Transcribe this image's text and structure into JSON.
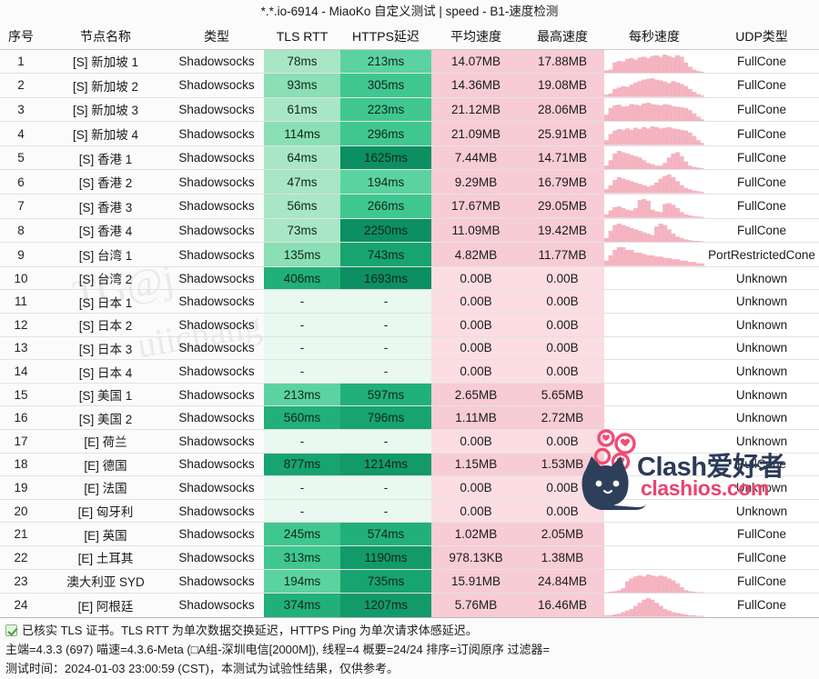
{
  "window": {
    "title": "*.*.io-6914 - MiaoKo 自定义测试 | speed - B1-速度检测"
  },
  "table": {
    "columns": [
      {
        "key": "idx",
        "label": "序号"
      },
      {
        "key": "name",
        "label": "节点名称"
      },
      {
        "key": "type",
        "label": "类型"
      },
      {
        "key": "tls",
        "label": "TLS RTT"
      },
      {
        "key": "https",
        "label": "HTTPS延迟"
      },
      {
        "key": "avg",
        "label": "平均速度"
      },
      {
        "key": "max",
        "label": "最高速度"
      },
      {
        "key": "sec",
        "label": "每秒速度"
      },
      {
        "key": "udp",
        "label": "UDP类型"
      }
    ],
    "rows": [
      {
        "idx": "1",
        "name": "[S] 新加坡 1",
        "type": "Shadowsocks",
        "tls": "78ms",
        "https": "213ms",
        "avg": "14.07MB",
        "max": "17.88MB",
        "udp": "FullCone",
        "tls_ms": 78,
        "https_ms": 213,
        "spark": [
          8,
          10,
          30,
          34,
          33,
          40,
          42,
          38,
          44,
          46,
          42,
          48,
          50,
          46,
          52,
          48,
          44,
          50,
          46,
          30,
          18,
          10,
          6,
          4
        ]
      },
      {
        "idx": "2",
        "name": "[S] 新加坡 2",
        "type": "Shadowsocks",
        "tls": "93ms",
        "https": "305ms",
        "avg": "14.36MB",
        "max": "19.08MB",
        "udp": "FullCone",
        "tls_ms": 93,
        "https_ms": 305,
        "spark": [
          6,
          10,
          22,
          26,
          30,
          28,
          34,
          40,
          44,
          48,
          50,
          52,
          48,
          46,
          42,
          38,
          44,
          40,
          36,
          30,
          22,
          14,
          8,
          4
        ]
      },
      {
        "idx": "3",
        "name": "[S] 新加坡 3",
        "type": "Shadowsocks",
        "tls": "61ms",
        "https": "223ms",
        "avg": "21.12MB",
        "max": "28.06MB",
        "udp": "FullCone",
        "tls_ms": 61,
        "https_ms": 223,
        "spark": [
          20,
          40,
          48,
          50,
          44,
          46,
          52,
          50,
          48,
          54,
          56,
          52,
          50,
          48,
          52,
          50,
          46,
          44,
          42,
          40,
          34,
          24,
          14,
          6
        ]
      },
      {
        "idx": "4",
        "name": "[S] 新加坡 4",
        "type": "Shadowsocks",
        "tls": "114ms",
        "https": "296ms",
        "avg": "21.09MB",
        "max": "25.91MB",
        "udp": "FullCone",
        "tls_ms": 114,
        "https_ms": 296,
        "spark": [
          14,
          32,
          42,
          46,
          44,
          48,
          44,
          50,
          46,
          52,
          48,
          54,
          52,
          48,
          50,
          52,
          48,
          46,
          44,
          42,
          36,
          26,
          14,
          6
        ]
      },
      {
        "idx": "5",
        "name": "[S] 香港 1",
        "type": "Shadowsocks",
        "tls": "64ms",
        "https": "1625ms",
        "avg": "7.44MB",
        "max": "14.71MB",
        "udp": "FullCone",
        "tls_ms": 64,
        "https_ms": 1625,
        "spark": [
          6,
          14,
          24,
          28,
          26,
          24,
          22,
          20,
          18,
          14,
          10,
          8,
          6,
          6,
          10,
          18,
          24,
          26,
          20,
          12,
          6,
          4,
          3,
          2
        ]
      },
      {
        "idx": "6",
        "name": "[S] 香港 2",
        "type": "Shadowsocks",
        "tls": "47ms",
        "https": "194ms",
        "avg": "9.29MB",
        "max": "16.79MB",
        "udp": "FullCone",
        "tls_ms": 47,
        "https_ms": 194,
        "spark": [
          6,
          12,
          20,
          24,
          22,
          20,
          18,
          16,
          14,
          12,
          10,
          12,
          16,
          22,
          26,
          28,
          24,
          18,
          12,
          8,
          6,
          4,
          3,
          2
        ]
      },
      {
        "idx": "7",
        "name": "[S] 香港 3",
        "type": "Shadowsocks",
        "tls": "56ms",
        "https": "266ms",
        "avg": "17.67MB",
        "max": "29.05MB",
        "udp": "FullCone",
        "tls_ms": 56,
        "https_ms": 266,
        "spark": [
          8,
          18,
          26,
          28,
          24,
          20,
          18,
          24,
          44,
          46,
          42,
          20,
          16,
          14,
          34,
          36,
          32,
          24,
          14,
          8,
          6,
          4,
          3,
          2
        ]
      },
      {
        "idx": "8",
        "name": "[S] 香港 4",
        "type": "Shadowsocks",
        "tls": "73ms",
        "https": "2250ms",
        "avg": "11.09MB",
        "max": "19.42MB",
        "udp": "FullCone",
        "tls_ms": 73,
        "https_ms": 2250,
        "spark": [
          6,
          16,
          24,
          26,
          24,
          22,
          20,
          18,
          16,
          14,
          12,
          10,
          22,
          26,
          24,
          18,
          12,
          8,
          6,
          4,
          3,
          2,
          2,
          1
        ]
      },
      {
        "idx": "9",
        "name": "[S] 台湾 1",
        "type": "Shadowsocks",
        "tls": "135ms",
        "https": "743ms",
        "avg": "4.82MB",
        "max": "11.77MB",
        "udp": "PortRestrictedCone",
        "tls_ms": 135,
        "https_ms": 743,
        "spark": [
          4,
          8,
          12,
          14,
          14,
          12,
          12,
          10,
          10,
          9,
          8,
          8,
          7,
          7,
          6,
          6,
          5,
          5,
          4,
          4,
          3,
          3,
          2,
          2
        ]
      },
      {
        "idx": "10",
        "name": "[S] 台湾 2",
        "type": "Shadowsocks",
        "tls": "406ms",
        "https": "1693ms",
        "avg": "0.00B",
        "max": "0.00B",
        "udp": "Unknown",
        "tls_ms": 406,
        "https_ms": 1693,
        "spark": []
      },
      {
        "idx": "11",
        "name": "[S] 日本 1",
        "type": "Shadowsocks",
        "tls": "-",
        "https": "-",
        "avg": "0.00B",
        "max": "0.00B",
        "udp": "Unknown",
        "tls_ms": null,
        "https_ms": null,
        "spark": []
      },
      {
        "idx": "12",
        "name": "[S] 日本 2",
        "type": "Shadowsocks",
        "tls": "-",
        "https": "-",
        "avg": "0.00B",
        "max": "0.00B",
        "udp": "Unknown",
        "tls_ms": null,
        "https_ms": null,
        "spark": []
      },
      {
        "idx": "13",
        "name": "[S] 日本 3",
        "type": "Shadowsocks",
        "tls": "-",
        "https": "-",
        "avg": "0.00B",
        "max": "0.00B",
        "udp": "Unknown",
        "tls_ms": null,
        "https_ms": null,
        "spark": []
      },
      {
        "idx": "14",
        "name": "[S] 日本 4",
        "type": "Shadowsocks",
        "tls": "-",
        "https": "-",
        "avg": "0.00B",
        "max": "0.00B",
        "udp": "Unknown",
        "tls_ms": null,
        "https_ms": null,
        "spark": []
      },
      {
        "idx": "15",
        "name": "[S] 美国 1",
        "type": "Shadowsocks",
        "tls": "213ms",
        "https": "597ms",
        "avg": "2.65MB",
        "max": "5.65MB",
        "udp": "Unknown",
        "tls_ms": 213,
        "https_ms": 597,
        "spark": []
      },
      {
        "idx": "16",
        "name": "[S] 美国 2",
        "type": "Shadowsocks",
        "tls": "560ms",
        "https": "796ms",
        "avg": "1.11MB",
        "max": "2.72MB",
        "udp": "Unknown",
        "tls_ms": 560,
        "https_ms": 796,
        "spark": []
      },
      {
        "idx": "17",
        "name": "[E] 荷兰",
        "type": "Shadowsocks",
        "tls": "-",
        "https": "-",
        "avg": "0.00B",
        "max": "0.00B",
        "udp": "Unknown",
        "tls_ms": null,
        "https_ms": null,
        "spark": []
      },
      {
        "idx": "18",
        "name": "[E] 德国",
        "type": "Shadowsocks",
        "tls": "877ms",
        "https": "1214ms",
        "avg": "1.15MB",
        "max": "1.53MB",
        "udp": "FullCone",
        "tls_ms": 877,
        "https_ms": 1214,
        "spark": []
      },
      {
        "idx": "19",
        "name": "[E] 法国",
        "type": "Shadowsocks",
        "tls": "-",
        "https": "-",
        "avg": "0.00B",
        "max": "0.00B",
        "udp": "Unknown",
        "tls_ms": null,
        "https_ms": null,
        "spark": []
      },
      {
        "idx": "20",
        "name": "[E] 匈牙利",
        "type": "Shadowsocks",
        "tls": "-",
        "https": "-",
        "avg": "0.00B",
        "max": "0.00B",
        "udp": "Unknown",
        "tls_ms": null,
        "https_ms": null,
        "spark": []
      },
      {
        "idx": "21",
        "name": "[E] 英国",
        "type": "Shadowsocks",
        "tls": "245ms",
        "https": "574ms",
        "avg": "1.02MB",
        "max": "2.05MB",
        "udp": "FullCone",
        "tls_ms": 245,
        "https_ms": 574,
        "spark": []
      },
      {
        "idx": "22",
        "name": "[E] 土耳其",
        "type": "Shadowsocks",
        "tls": "313ms",
        "https": "1190ms",
        "avg": "978.13KB",
        "max": "1.38MB",
        "udp": "FullCone",
        "tls_ms": 313,
        "https_ms": 1190,
        "spark": []
      },
      {
        "idx": "23",
        "name": "澳大利亚 SYD",
        "type": "Shadowsocks",
        "tls": "194ms",
        "https": "735ms",
        "avg": "15.91MB",
        "max": "24.84MB",
        "udp": "FullCone",
        "tls_ms": 194,
        "https_ms": 735,
        "spark": [
          2,
          3,
          4,
          6,
          10,
          24,
          30,
          34,
          36,
          34,
          38,
          36,
          34,
          36,
          34,
          30,
          26,
          20,
          12,
          6,
          4,
          3,
          2,
          2
        ]
      },
      {
        "idx": "24",
        "name": "[E] 阿根廷",
        "type": "Shadowsocks",
        "tls": "374ms",
        "https": "1207ms",
        "avg": "5.76MB",
        "max": "16.46MB",
        "udp": "FullCone",
        "tls_ms": 374,
        "https_ms": 1207,
        "spark": [
          2,
          2,
          3,
          4,
          6,
          8,
          10,
          14,
          18,
          22,
          24,
          22,
          18,
          14,
          10,
          8,
          6,
          5,
          4,
          3,
          2,
          2,
          1,
          1
        ]
      }
    ]
  },
  "footer": {
    "note": "已核实 TLS 证书。TLS RTT 为单次数据交换延迟，HTTPS Ping 为单次请求体感延迟。",
    "info": "主端=4.3.3 (697) 喵速=4.3.6-Meta (□A组-深圳电信[2000M]), 线程=4 概要=24/24 排序=订阅原序 过滤器=",
    "timestamp": "测试时间：2024-01-03 23:00:59 (CST)，本测试为试验性结果，仅供参考。"
  },
  "watermarks": {
    "bg": [
      "TG@j",
      "uiichang",
      "uiichang",
      "uiichang"
    ],
    "logo_name": "Clash爱好者",
    "logo_site": "clashios.com"
  },
  "colors": {
    "latency_fast": "#b6e8cd",
    "latency_mid": "#57cf9f",
    "latency_slow": "#0e9b68",
    "latency_empty": "#e9f8f0",
    "speed_bg": "#f8cfd6",
    "spark_fill": "#f2a8b6",
    "accent_pink": "#e8456f",
    "logo_navy": "#2b3a57"
  }
}
